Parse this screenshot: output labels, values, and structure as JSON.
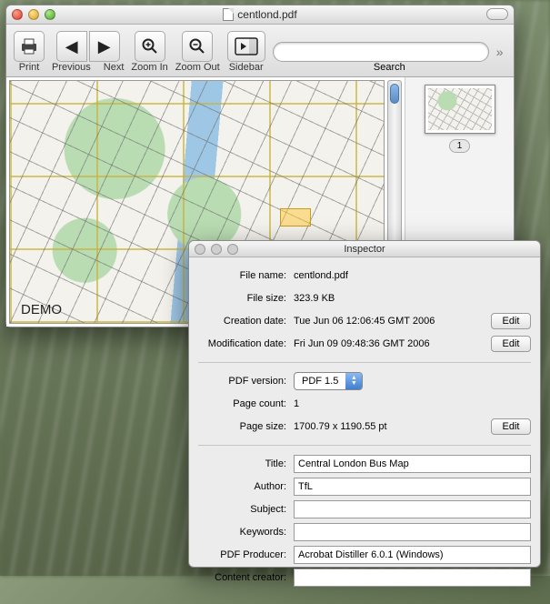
{
  "window": {
    "title": "centlond.pdf"
  },
  "toolbar": {
    "print": "Print",
    "previous": "Previous",
    "next": "Next",
    "zoom_in": "Zoom In",
    "zoom_out": "Zoom Out",
    "sidebar": "Sidebar",
    "search_label": "Search",
    "search_placeholder": ""
  },
  "map": {
    "demo_label": "DEMO"
  },
  "thumbs": {
    "page1_label": "1"
  },
  "inspector": {
    "title": "Inspector",
    "labels": {
      "file_name": "File name:",
      "file_size": "File size:",
      "creation_date": "Creation date:",
      "modification_date": "Modification date:",
      "pdf_version": "PDF version:",
      "page_count": "Page count:",
      "page_size": "Page size:",
      "title": "Title:",
      "author": "Author:",
      "subject": "Subject:",
      "keywords": "Keywords:",
      "pdf_producer": "PDF Producer:",
      "content_creator": "Content creator:"
    },
    "values": {
      "file_name": "centlond.pdf",
      "file_size": "323.9 KB",
      "creation_date": "Tue Jun 06 12:06:45 GMT 2006",
      "modification_date": "Fri Jun 09 09:48:36 GMT 2006",
      "pdf_version_selected": "PDF 1.5",
      "page_count": "1",
      "page_size": "1700.79 x 1190.55 pt",
      "title": "Central London Bus Map",
      "author": "TfL",
      "subject": "",
      "keywords": "",
      "pdf_producer": "Acrobat Distiller 6.0.1 (Windows)",
      "content_creator": ""
    },
    "buttons": {
      "edit": "Edit"
    }
  }
}
